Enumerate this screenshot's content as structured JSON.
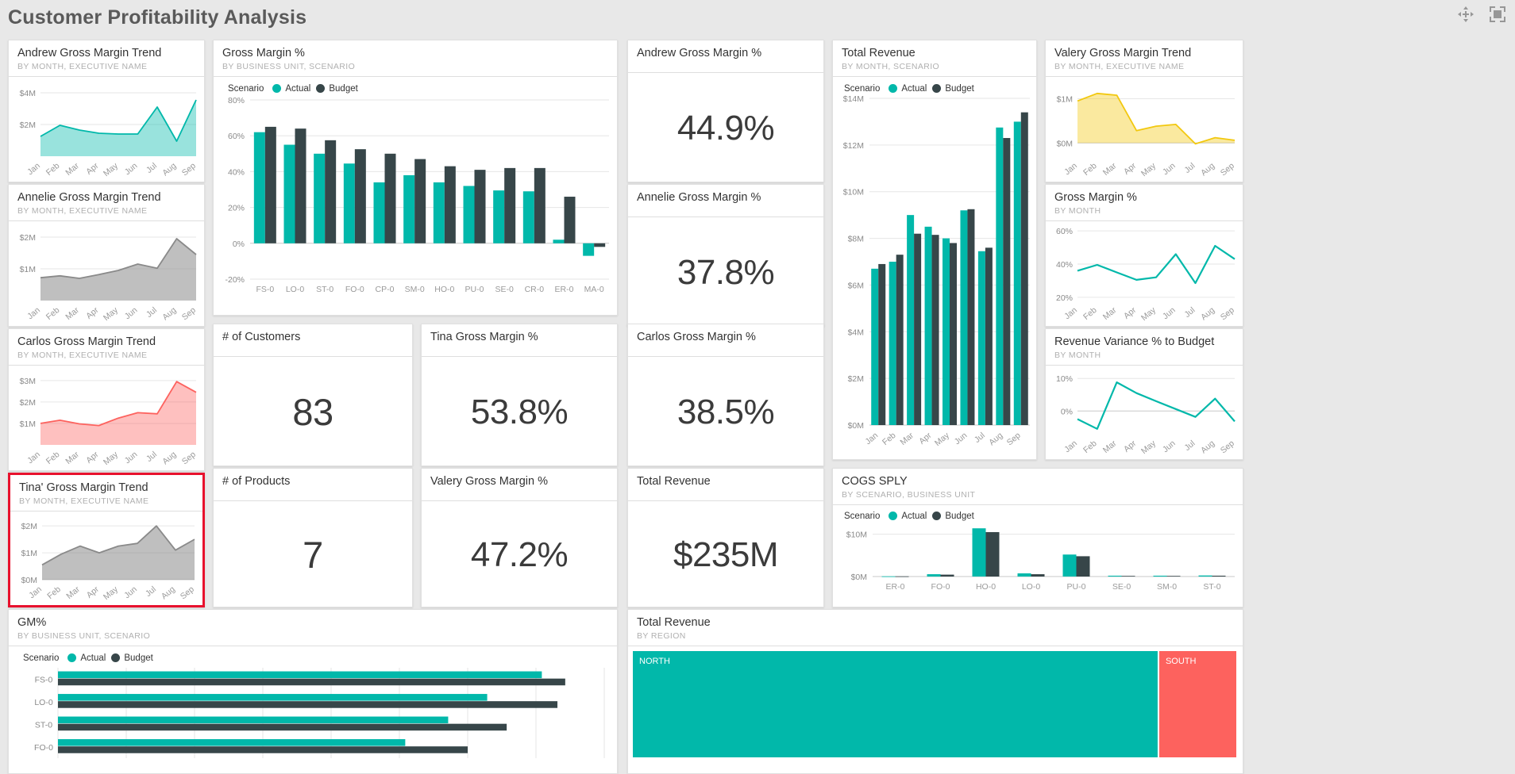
{
  "header": {
    "title": "Customer Profitability Analysis",
    "icons": [
      {
        "name": "focus-mode-icon",
        "glyph": "move"
      },
      {
        "name": "fit-to-screen-icon",
        "glyph": "fit"
      }
    ]
  },
  "colors": {
    "actual": "#01b8aa",
    "budget": "#374649",
    "yellow": "#f2c80f",
    "red": "#fd625e",
    "gray_area": "#a6a6a6",
    "pink": "#fd625e",
    "selection_border": "#e8112d",
    "page_bg": "#e8e8e8",
    "card_bg": "#ffffff"
  },
  "legend": {
    "label": "Scenario",
    "actual": "Actual",
    "budget": "Budget"
  },
  "months": [
    "Jan",
    "Feb",
    "Mar",
    "Apr",
    "May",
    "Jun",
    "Jul",
    "Aug",
    "Sep"
  ],
  "cards": {
    "andrew_trend": {
      "title": "Andrew Gross Margin Trend",
      "subtitle": "BY MONTH, EXECUTIVE NAME"
    },
    "annelie_trend": {
      "title": "Annelie Gross Margin Trend",
      "subtitle": "BY MONTH, EXECUTIVE NAME"
    },
    "carlos_trend": {
      "title": "Carlos Gross Margin Trend",
      "subtitle": "BY MONTH, EXECUTIVE NAME"
    },
    "tina_trend": {
      "title": "Tina' Gross Margin Trend",
      "subtitle": "BY MONTH, EXECUTIVE NAME",
      "selected": true
    },
    "gm_pct_bu": {
      "title": "Gross Margin %",
      "subtitle": "BY BUSINESS UNIT, SCENARIO"
    },
    "num_customers": {
      "title": "# of Customers",
      "value": "83"
    },
    "num_products": {
      "title": "# of Products",
      "value": "7"
    },
    "tina_gm": {
      "title": "Tina Gross Margin %",
      "value": "53.8%"
    },
    "valery_gm": {
      "title": "Valery Gross Margin %",
      "value": "47.2%"
    },
    "andrew_gm": {
      "title": "Andrew Gross Margin %",
      "value": "44.9%"
    },
    "annelie_gm": {
      "title": "Annelie Gross Margin %",
      "value": "37.8%"
    },
    "carlos_gm": {
      "title": "Carlos Gross Margin %",
      "value": "38.5%"
    },
    "total_rev_kpi": {
      "title": "Total Revenue",
      "value": "$235M"
    },
    "total_rev_month": {
      "title": "Total Revenue",
      "subtitle": "BY MONTH, SCENARIO"
    },
    "valery_trend": {
      "title": "Valery Gross Margin Trend",
      "subtitle": "BY MONTH, EXECUTIVE NAME"
    },
    "gm_pct_month": {
      "title": "Gross Margin %",
      "subtitle": "BY MONTH"
    },
    "rev_variance": {
      "title": "Revenue Variance % to Budget",
      "subtitle": "BY MONTH"
    },
    "cogs_sply": {
      "title": "COGS SPLY",
      "subtitle": "BY SCENARIO, BUSINESS UNIT"
    },
    "gm_pct_bar": {
      "title": "GM%",
      "subtitle": "BY BUSINESS UNIT, SCENARIO"
    },
    "total_rev_tree": {
      "title": "Total Revenue",
      "subtitle": "BY REGION"
    }
  },
  "chart_data": [
    {
      "id": "gm_pct_bu",
      "type": "bar",
      "title": "Gross Margin %",
      "subtitle": "BY BUSINESS UNIT, SCENARIO",
      "categories": [
        "FS-0",
        "LO-0",
        "ST-0",
        "FO-0",
        "CP-0",
        "SM-0",
        "HO-0",
        "PU-0",
        "SE-0",
        "CR-0",
        "ER-0",
        "MA-0"
      ],
      "series": [
        {
          "name": "Actual",
          "values": [
            62,
            55,
            50,
            44.5,
            34,
            38,
            34,
            32,
            29.5,
            29,
            2,
            -7
          ]
        },
        {
          "name": "Budget",
          "values": [
            65,
            64,
            57.5,
            52.5,
            50,
            47,
            43,
            41,
            42,
            42,
            26,
            -2
          ]
        }
      ],
      "ytick_labels": [
        "80%",
        "60%",
        "40%",
        "20%",
        "0%",
        "-20%"
      ],
      "ylim": [
        -20,
        80
      ],
      "xlabel": "",
      "ylabel": "",
      "grid": true,
      "legend": "top-left"
    },
    {
      "id": "total_rev_month",
      "type": "bar",
      "title": "Total Revenue",
      "subtitle": "BY MONTH, SCENARIO",
      "categories": [
        "Jan",
        "Feb",
        "Mar",
        "Apr",
        "May",
        "Jun",
        "Jul",
        "Aug",
        "Sep"
      ],
      "series": [
        {
          "name": "Actual",
          "values": [
            6.7,
            7.0,
            9.0,
            8.5,
            8.0,
            9.2,
            7.45,
            12.75,
            13.0
          ]
        },
        {
          "name": "Budget",
          "values": [
            6.9,
            7.3,
            8.2,
            8.15,
            7.8,
            9.25,
            7.6,
            12.3,
            13.4
          ]
        }
      ],
      "ytick_labels": [
        "$14M",
        "$12M",
        "$10M",
        "$8M",
        "$6M",
        "$4M",
        "$2M",
        "$0M"
      ],
      "ylim": [
        0,
        14
      ],
      "grid": true,
      "legend": "top-left"
    },
    {
      "id": "cogs_sply",
      "type": "bar",
      "title": "COGS SPLY",
      "subtitle": "BY SCENARIO, BUSINESS UNIT",
      "categories": [
        "ER-0",
        "FO-0",
        "HO-0",
        "LO-0",
        "PU-0",
        "SE-0",
        "SM-0",
        "ST-0"
      ],
      "series": [
        {
          "name": "Actual",
          "values": [
            0.05,
            0.55,
            11.4,
            0.75,
            5.2,
            0.2,
            0.2,
            0.25
          ]
        },
        {
          "name": "Budget",
          "values": [
            0.05,
            0.45,
            10.5,
            0.55,
            4.8,
            0.15,
            0.15,
            0.2
          ]
        }
      ],
      "ytick_labels": [
        "$10M",
        "$0M"
      ],
      "ylim": [
        0,
        12
      ],
      "grid": true,
      "legend": "top-left"
    },
    {
      "id": "gm_pct_bar",
      "type": "bar",
      "orientation": "horizontal",
      "title": "GM%",
      "subtitle": "BY BUSINESS UNIT, SCENARIO",
      "categories": [
        "FS-0",
        "LO-0",
        "ST-0",
        "FO-0"
      ],
      "series": [
        {
          "name": "Actual",
          "values": [
            62,
            55,
            50,
            44.5
          ]
        },
        {
          "name": "Budget",
          "values": [
            65,
            64,
            57.5,
            52.5
          ]
        }
      ],
      "grid": true,
      "legend": "top-left"
    },
    {
      "id": "andrew_trend",
      "type": "area",
      "title": "Andrew Gross Margin Trend",
      "subtitle": "BY MONTH, EXECUTIVE NAME",
      "x": [
        "Jan",
        "Feb",
        "Mar",
        "Apr",
        "May",
        "Jun",
        "Jul",
        "Aug",
        "Sep"
      ],
      "values": [
        1.25,
        1.95,
        1.65,
        1.45,
        1.4,
        1.4,
        3.1,
        0.95,
        3.55
      ],
      "ytick_labels": [
        "$4M",
        "$2M"
      ],
      "ylim": [
        0,
        4.6
      ],
      "color": "#01b8aa"
    },
    {
      "id": "annelie_trend",
      "type": "area",
      "title": "Annelie Gross Margin Trend",
      "subtitle": "BY MONTH, EXECUTIVE NAME",
      "x": [
        "Jan",
        "Feb",
        "Mar",
        "Apr",
        "May",
        "Jun",
        "Jul",
        "Aug",
        "Sep"
      ],
      "values": [
        0.72,
        0.78,
        0.7,
        0.82,
        0.95,
        1.15,
        1.02,
        1.95,
        1.45
      ],
      "ytick_labels": [
        "$2M",
        "$1M"
      ],
      "ylim": [
        0,
        2.3
      ],
      "color": "#8a8a8a"
    },
    {
      "id": "carlos_trend",
      "type": "area",
      "title": "Carlos Gross Margin Trend",
      "subtitle": "BY MONTH, EXECUTIVE NAME",
      "x": [
        "Jan",
        "Feb",
        "Mar",
        "Apr",
        "May",
        "Jun",
        "Jul",
        "Aug",
        "Sep"
      ],
      "values": [
        1.0,
        1.15,
        0.98,
        0.9,
        1.25,
        1.5,
        1.45,
        2.95,
        2.45
      ],
      "ytick_labels": [
        "$3M",
        "$2M",
        "$1M"
      ],
      "ylim": [
        0,
        3.4
      ],
      "color": "#fd625e"
    },
    {
      "id": "tina_trend",
      "type": "area",
      "title": "Tina' Gross Margin Trend",
      "subtitle": "BY MONTH, EXECUTIVE NAME",
      "x": [
        "Jan",
        "Feb",
        "Mar",
        "Apr",
        "May",
        "Jun",
        "Jul",
        "Aug",
        "Sep"
      ],
      "values": [
        0.55,
        0.95,
        1.25,
        1.0,
        1.25,
        1.35,
        2.0,
        1.1,
        1.5
      ],
      "ytick_labels": [
        "$2M",
        "$1M",
        "$0M"
      ],
      "ylim": [
        0,
        2.3
      ],
      "color": "#8a8a8a"
    },
    {
      "id": "valery_trend",
      "type": "area",
      "title": "Valery Gross Margin Trend",
      "subtitle": "BY MONTH, EXECUTIVE NAME",
      "x": [
        "Jan",
        "Feb",
        "Mar",
        "Apr",
        "May",
        "Jun",
        "Jul",
        "Aug",
        "Sep"
      ],
      "values": [
        0.95,
        1.12,
        1.08,
        0.28,
        0.38,
        0.42,
        -0.02,
        0.12,
        0.06
      ],
      "ytick_labels": [
        "$1M",
        "$0M"
      ],
      "ylim": [
        -0.3,
        1.35
      ],
      "color": "#f2c80f"
    },
    {
      "id": "gm_pct_month",
      "type": "line",
      "title": "Gross Margin %",
      "subtitle": "BY MONTH",
      "x": [
        "Jan",
        "Feb",
        "Mar",
        "Apr",
        "May",
        "Jun",
        "Jul",
        "Aug",
        "Sep"
      ],
      "values": [
        36,
        39.5,
        35,
        30.5,
        32,
        46,
        28.5,
        51,
        43
      ],
      "ytick_labels": [
        "60%",
        "40%",
        "20%"
      ],
      "ylim": [
        18,
        62
      ],
      "color": "#01b8aa"
    },
    {
      "id": "rev_variance",
      "type": "line",
      "title": "Revenue Variance % to Budget",
      "subtitle": "BY MONTH",
      "x": [
        "Jan",
        "Feb",
        "Mar",
        "Apr",
        "May",
        "Jun",
        "Jul",
        "Aug",
        "Sep"
      ],
      "values": [
        -2.5,
        -5.5,
        8.8,
        5.5,
        3.0,
        0.6,
        -1.8,
        3.8,
        -3.2
      ],
      "ytick_labels": [
        "10%",
        "0%"
      ],
      "ylim": [
        -7,
        12
      ],
      "color": "#01b8aa"
    },
    {
      "id": "total_rev_tree",
      "type": "treemap",
      "title": "Total Revenue",
      "subtitle": "BY REGION",
      "nodes": [
        {
          "label": "NORTH",
          "color": "#01b8aa",
          "weight": 0.87
        },
        {
          "label": "SOUTH",
          "color": "#fd625e",
          "weight": 0.13
        }
      ]
    }
  ]
}
